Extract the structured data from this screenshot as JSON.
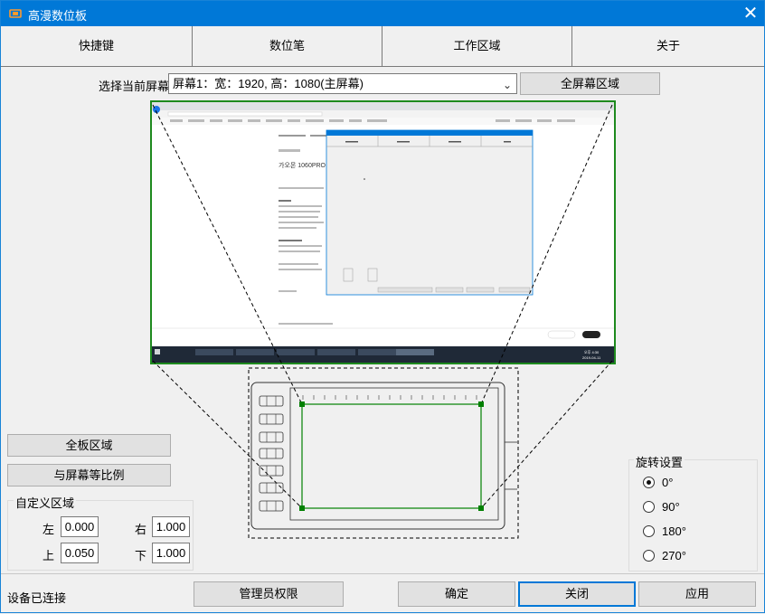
{
  "window": {
    "title": "高漫数位板",
    "close": "✕"
  },
  "tabs": [
    "快捷键",
    "数位笔",
    "工作区域",
    "关于"
  ],
  "screen_row": {
    "label": "选择当前屏幕",
    "selected": "屏幕1：宽：1920, 高：1080(主屏幕)",
    "fullscreen_btn": "全屏幕区域"
  },
  "left_buttons": {
    "full_board": "全板区域",
    "ratio": "与屏幕等比例"
  },
  "custom_area": {
    "title": "自定义区域",
    "left_label": "左",
    "left_value": "0.000",
    "right_label": "右",
    "right_value": "1.000",
    "top_label": "上",
    "top_value": "0.050",
    "bottom_label": "下",
    "bottom_value": "1.000"
  },
  "rotation": {
    "title": "旋转设置",
    "options": [
      "0°",
      "90°",
      "180°",
      "270°"
    ],
    "selected_index": 0
  },
  "footer": {
    "status": "设备已连接",
    "admin_btn": "管理员权限",
    "ok_btn": "确定",
    "close_btn": "关闭",
    "apply_btn": "应用"
  },
  "preview": {
    "page_heading": "가오몬 1060PRO",
    "dialog_tabs": [
      "快捷键",
      "数位笔",
      "工作区域",
      "关于"
    ],
    "taskbar_time": "오후 4:30",
    "taskbar_date": "2019-04-11"
  },
  "colors": {
    "accent": "#0078d7",
    "frame_green": "#1e8a1e",
    "area_green": "#008000"
  }
}
